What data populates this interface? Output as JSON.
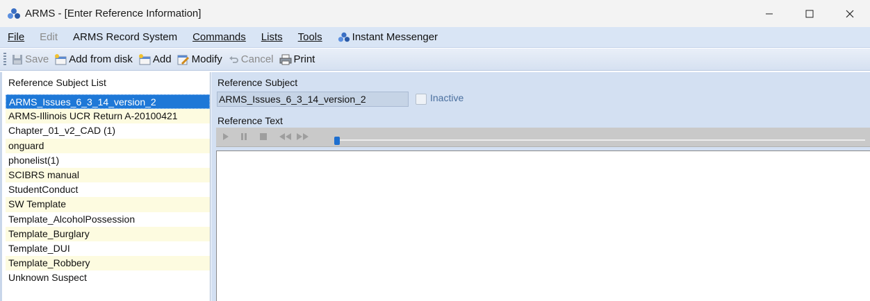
{
  "window": {
    "title": "ARMS - [Enter Reference Information]",
    "controls": [
      "minimize",
      "maximize",
      "close"
    ]
  },
  "menu": {
    "file": "File",
    "edit": "Edit",
    "arms_record_system": "ARMS Record System",
    "commands": "Commands",
    "lists": "Lists",
    "tools": "Tools",
    "instant_messenger": "Instant Messenger"
  },
  "toolbar": {
    "save": "Save",
    "add_from_disk": "Add from disk",
    "add": "Add",
    "modify": "Modify",
    "cancel": "Cancel",
    "print": "Print"
  },
  "reference_list": {
    "header": "Reference Subject List",
    "selected_index": 0,
    "items": [
      "ARMS_Issues_6_3_14_version_2",
      "ARMS-Illinois UCR Return A-20100421",
      "Chapter_01_v2_CAD (1)",
      "onguard",
      "phonelist(1)",
      "SCIBRS manual",
      "StudentConduct",
      "SW Template",
      "Template_AlcoholPossession",
      "Template_Burglary",
      "Template_DUI",
      "Template_Robbery",
      "Unknown Suspect"
    ]
  },
  "detail": {
    "subject_label": "Reference Subject",
    "subject_value": "ARMS_Issues_6_3_14_version_2",
    "inactive_label": "Inactive",
    "inactive_checked": false,
    "text_label": "Reference Text",
    "reference_text": ""
  },
  "media_player": {
    "buttons": [
      "play-icon",
      "pause-icon",
      "stop-icon",
      "rewind-icon",
      "fast-forward-icon"
    ],
    "position_fraction": 0
  },
  "colors": {
    "selection": "#1e78d7",
    "alt_row": "#fdfbe0",
    "menubar": "#d9e5f5",
    "panel": "#d3e0f2"
  }
}
